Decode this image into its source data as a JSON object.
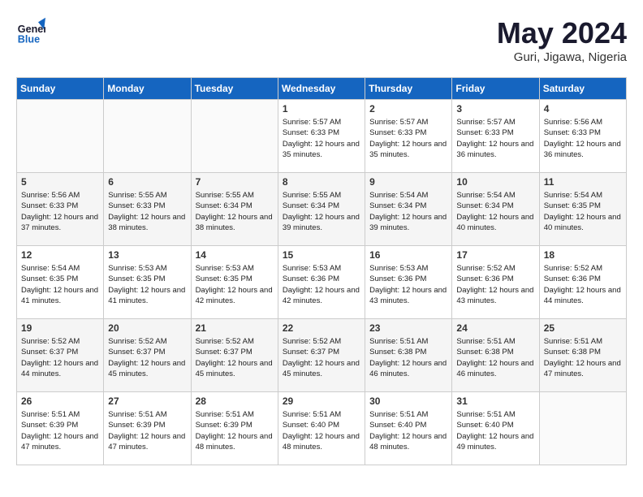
{
  "header": {
    "logo_line1": "General",
    "logo_line2": "Blue",
    "month_year": "May 2024",
    "location": "Guri, Jigawa, Nigeria"
  },
  "weekdays": [
    "Sunday",
    "Monday",
    "Tuesday",
    "Wednesday",
    "Thursday",
    "Friday",
    "Saturday"
  ],
  "weeks": [
    [
      {
        "day": "",
        "sunrise": "",
        "sunset": "",
        "daylight": ""
      },
      {
        "day": "",
        "sunrise": "",
        "sunset": "",
        "daylight": ""
      },
      {
        "day": "",
        "sunrise": "",
        "sunset": "",
        "daylight": ""
      },
      {
        "day": "1",
        "sunrise": "Sunrise: 5:57 AM",
        "sunset": "Sunset: 6:33 PM",
        "daylight": "Daylight: 12 hours and 35 minutes."
      },
      {
        "day": "2",
        "sunrise": "Sunrise: 5:57 AM",
        "sunset": "Sunset: 6:33 PM",
        "daylight": "Daylight: 12 hours and 35 minutes."
      },
      {
        "day": "3",
        "sunrise": "Sunrise: 5:57 AM",
        "sunset": "Sunset: 6:33 PM",
        "daylight": "Daylight: 12 hours and 36 minutes."
      },
      {
        "day": "4",
        "sunrise": "Sunrise: 5:56 AM",
        "sunset": "Sunset: 6:33 PM",
        "daylight": "Daylight: 12 hours and 36 minutes."
      }
    ],
    [
      {
        "day": "5",
        "sunrise": "Sunrise: 5:56 AM",
        "sunset": "Sunset: 6:33 PM",
        "daylight": "Daylight: 12 hours and 37 minutes."
      },
      {
        "day": "6",
        "sunrise": "Sunrise: 5:55 AM",
        "sunset": "Sunset: 6:33 PM",
        "daylight": "Daylight: 12 hours and 38 minutes."
      },
      {
        "day": "7",
        "sunrise": "Sunrise: 5:55 AM",
        "sunset": "Sunset: 6:34 PM",
        "daylight": "Daylight: 12 hours and 38 minutes."
      },
      {
        "day": "8",
        "sunrise": "Sunrise: 5:55 AM",
        "sunset": "Sunset: 6:34 PM",
        "daylight": "Daylight: 12 hours and 39 minutes."
      },
      {
        "day": "9",
        "sunrise": "Sunrise: 5:54 AM",
        "sunset": "Sunset: 6:34 PM",
        "daylight": "Daylight: 12 hours and 39 minutes."
      },
      {
        "day": "10",
        "sunrise": "Sunrise: 5:54 AM",
        "sunset": "Sunset: 6:34 PM",
        "daylight": "Daylight: 12 hours and 40 minutes."
      },
      {
        "day": "11",
        "sunrise": "Sunrise: 5:54 AM",
        "sunset": "Sunset: 6:35 PM",
        "daylight": "Daylight: 12 hours and 40 minutes."
      }
    ],
    [
      {
        "day": "12",
        "sunrise": "Sunrise: 5:54 AM",
        "sunset": "Sunset: 6:35 PM",
        "daylight": "Daylight: 12 hours and 41 minutes."
      },
      {
        "day": "13",
        "sunrise": "Sunrise: 5:53 AM",
        "sunset": "Sunset: 6:35 PM",
        "daylight": "Daylight: 12 hours and 41 minutes."
      },
      {
        "day": "14",
        "sunrise": "Sunrise: 5:53 AM",
        "sunset": "Sunset: 6:35 PM",
        "daylight": "Daylight: 12 hours and 42 minutes."
      },
      {
        "day": "15",
        "sunrise": "Sunrise: 5:53 AM",
        "sunset": "Sunset: 6:36 PM",
        "daylight": "Daylight: 12 hours and 42 minutes."
      },
      {
        "day": "16",
        "sunrise": "Sunrise: 5:53 AM",
        "sunset": "Sunset: 6:36 PM",
        "daylight": "Daylight: 12 hours and 43 minutes."
      },
      {
        "day": "17",
        "sunrise": "Sunrise: 5:52 AM",
        "sunset": "Sunset: 6:36 PM",
        "daylight": "Daylight: 12 hours and 43 minutes."
      },
      {
        "day": "18",
        "sunrise": "Sunrise: 5:52 AM",
        "sunset": "Sunset: 6:36 PM",
        "daylight": "Daylight: 12 hours and 44 minutes."
      }
    ],
    [
      {
        "day": "19",
        "sunrise": "Sunrise: 5:52 AM",
        "sunset": "Sunset: 6:37 PM",
        "daylight": "Daylight: 12 hours and 44 minutes."
      },
      {
        "day": "20",
        "sunrise": "Sunrise: 5:52 AM",
        "sunset": "Sunset: 6:37 PM",
        "daylight": "Daylight: 12 hours and 45 minutes."
      },
      {
        "day": "21",
        "sunrise": "Sunrise: 5:52 AM",
        "sunset": "Sunset: 6:37 PM",
        "daylight": "Daylight: 12 hours and 45 minutes."
      },
      {
        "day": "22",
        "sunrise": "Sunrise: 5:52 AM",
        "sunset": "Sunset: 6:37 PM",
        "daylight": "Daylight: 12 hours and 45 minutes."
      },
      {
        "day": "23",
        "sunrise": "Sunrise: 5:51 AM",
        "sunset": "Sunset: 6:38 PM",
        "daylight": "Daylight: 12 hours and 46 minutes."
      },
      {
        "day": "24",
        "sunrise": "Sunrise: 5:51 AM",
        "sunset": "Sunset: 6:38 PM",
        "daylight": "Daylight: 12 hours and 46 minutes."
      },
      {
        "day": "25",
        "sunrise": "Sunrise: 5:51 AM",
        "sunset": "Sunset: 6:38 PM",
        "daylight": "Daylight: 12 hours and 47 minutes."
      }
    ],
    [
      {
        "day": "26",
        "sunrise": "Sunrise: 5:51 AM",
        "sunset": "Sunset: 6:39 PM",
        "daylight": "Daylight: 12 hours and 47 minutes."
      },
      {
        "day": "27",
        "sunrise": "Sunrise: 5:51 AM",
        "sunset": "Sunset: 6:39 PM",
        "daylight": "Daylight: 12 hours and 47 minutes."
      },
      {
        "day": "28",
        "sunrise": "Sunrise: 5:51 AM",
        "sunset": "Sunset: 6:39 PM",
        "daylight": "Daylight: 12 hours and 48 minutes."
      },
      {
        "day": "29",
        "sunrise": "Sunrise: 5:51 AM",
        "sunset": "Sunset: 6:40 PM",
        "daylight": "Daylight: 12 hours and 48 minutes."
      },
      {
        "day": "30",
        "sunrise": "Sunrise: 5:51 AM",
        "sunset": "Sunset: 6:40 PM",
        "daylight": "Daylight: 12 hours and 48 minutes."
      },
      {
        "day": "31",
        "sunrise": "Sunrise: 5:51 AM",
        "sunset": "Sunset: 6:40 PM",
        "daylight": "Daylight: 12 hours and 49 minutes."
      },
      {
        "day": "",
        "sunrise": "",
        "sunset": "",
        "daylight": ""
      }
    ]
  ]
}
